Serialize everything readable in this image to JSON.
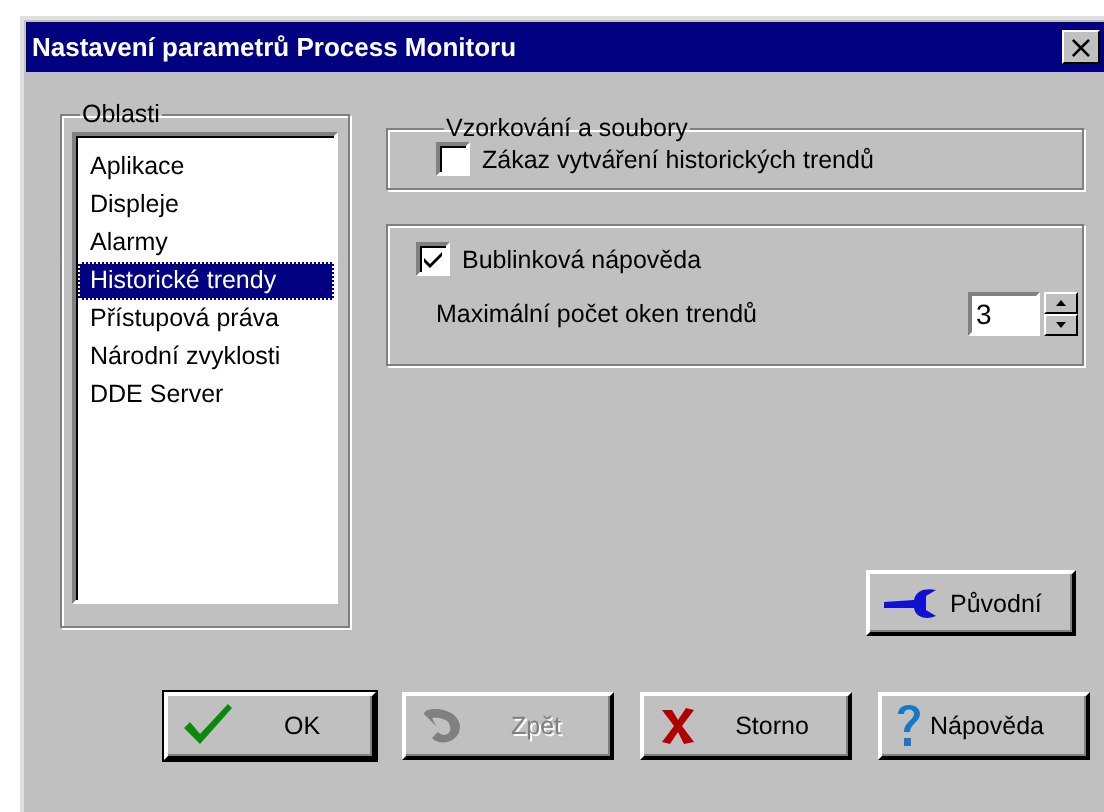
{
  "window": {
    "title": "Nastavení parametrů Process Monitoru",
    "close": "×"
  },
  "areas": {
    "label": "Oblasti",
    "items": [
      {
        "label": "Aplikace",
        "selected": false
      },
      {
        "label": "Displeje",
        "selected": false
      },
      {
        "label": "Alarmy",
        "selected": false
      },
      {
        "label": "Historické trendy",
        "selected": true
      },
      {
        "label": "Přístupová práva",
        "selected": false
      },
      {
        "label": "Národní zvyklosti",
        "selected": false
      },
      {
        "label": "DDE Server",
        "selected": false
      }
    ]
  },
  "sampling": {
    "label": "Vzorkování a soubory",
    "checkbox": {
      "label": "Zákaz vytváření historických trendů",
      "checked": false
    }
  },
  "options": {
    "checkbox": {
      "label": "Bublinková nápověda",
      "checked": true
    },
    "spinner": {
      "label": "Maximální počet oken trendů",
      "value": "3"
    }
  },
  "reset_button": {
    "label": "Původní"
  },
  "buttons": [
    {
      "kind": "ok",
      "label": "OK",
      "disabled": false
    },
    {
      "kind": "back",
      "label": "Zpět",
      "disabled": true
    },
    {
      "kind": "cancel",
      "label": "Storno",
      "disabled": false
    },
    {
      "kind": "help",
      "label": "Nápověda",
      "disabled": false
    }
  ]
}
